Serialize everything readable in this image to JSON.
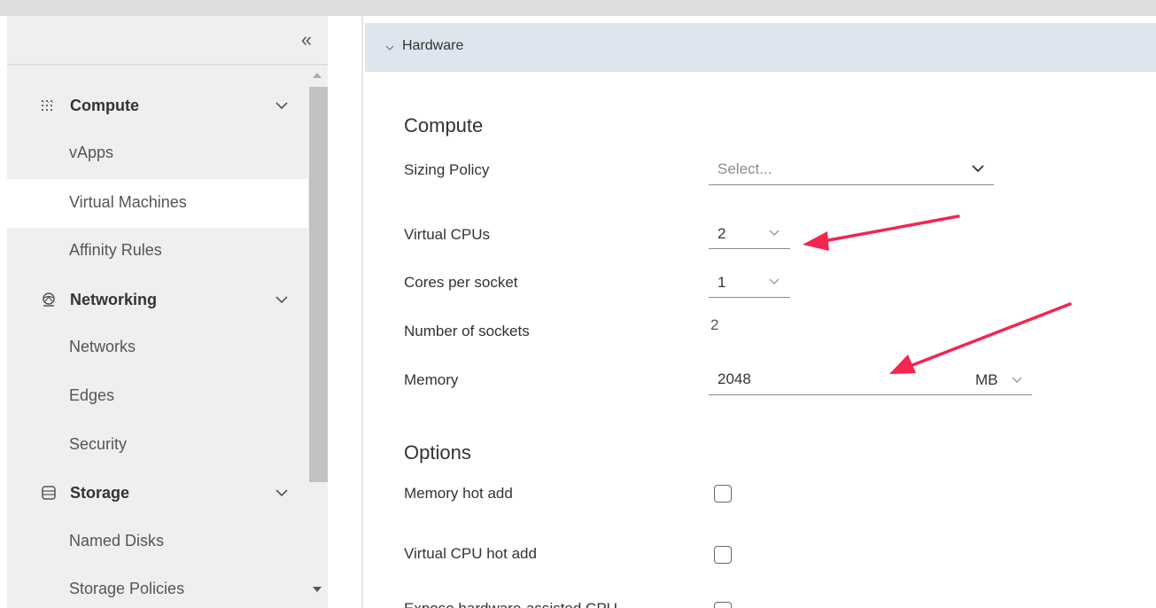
{
  "sidebar": {
    "collapse_glyph": "«",
    "sections": [
      {
        "label": "Compute",
        "icon": "grid-icon",
        "items": [
          "vApps",
          "Virtual Machines",
          "Affinity Rules"
        ]
      },
      {
        "label": "Networking",
        "icon": "network-icon",
        "items": [
          "Networks",
          "Edges",
          "Security"
        ]
      },
      {
        "label": "Storage",
        "icon": "database-icon",
        "items": [
          "Named Disks",
          "Storage Policies"
        ]
      }
    ],
    "active_item": "Virtual Machines"
  },
  "panel": {
    "title": "Hardware",
    "compute_title": "Compute",
    "sizing_policy": {
      "label": "Sizing Policy",
      "placeholder": "Select..."
    },
    "virtual_cpus": {
      "label": "Virtual CPUs",
      "value": "2"
    },
    "cores_per_socket": {
      "label": "Cores per socket",
      "value": "1"
    },
    "number_of_sockets": {
      "label": "Number of sockets",
      "value": "2"
    },
    "memory": {
      "label": "Memory",
      "value": "2048",
      "unit": "MB"
    },
    "options_title": "Options",
    "options": [
      {
        "label": "Memory hot add",
        "checked": false
      },
      {
        "label": "Virtual CPU hot add",
        "checked": false
      },
      {
        "label": "Expose hardware-assisted CPU",
        "checked": false
      }
    ]
  },
  "colors": {
    "sidebar_bg": "#efefef",
    "header_bg": "#dde6ee",
    "annotation_arrow": "#f2264f"
  }
}
